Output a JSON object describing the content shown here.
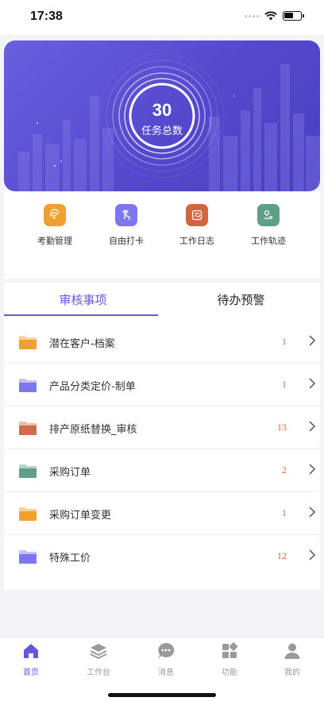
{
  "status_bar": {
    "time": "17:38"
  },
  "banner": {
    "count": "30",
    "label": "任务总数"
  },
  "quick_actions": [
    {
      "label": "考勤管理",
      "icon": "fingerprint-icon",
      "color": "#f0a030"
    },
    {
      "label": "自由打卡",
      "icon": "tap-icon",
      "color": "#7b78f0"
    },
    {
      "label": "工作日志",
      "icon": "note-icon",
      "color": "#d0653f"
    },
    {
      "label": "工作轨迹",
      "icon": "track-icon",
      "color": "#5f9f88"
    }
  ],
  "tabs": {
    "review": "审核事项",
    "todo": "待办预警"
  },
  "items": [
    {
      "label": "潜在客户-档案",
      "count": "1",
      "color": "#f0a030"
    },
    {
      "label": "产品分类定价-制单",
      "count": "1",
      "color": "#7b78f0"
    },
    {
      "label": "排产原纸替换_审核",
      "count": "13",
      "color": "#cf6a4a"
    },
    {
      "label": "采购订单",
      "count": "2",
      "color": "#5f9f88"
    },
    {
      "label": "采购订单变更",
      "count": "1",
      "color": "#f0a030"
    },
    {
      "label": "特殊工价",
      "count": "12",
      "color": "#7b78f0"
    }
  ],
  "tabbar": [
    {
      "label": "首页",
      "icon": "home-icon",
      "active": true
    },
    {
      "label": "工作台",
      "icon": "layers-icon",
      "active": false
    },
    {
      "label": "消息",
      "icon": "message-icon",
      "active": false
    },
    {
      "label": "功能",
      "icon": "grid-icon",
      "active": false
    },
    {
      "label": "我的",
      "icon": "profile-icon",
      "active": false
    }
  ],
  "colors": {
    "accent": "#6459d8",
    "count": "#d9663b"
  }
}
